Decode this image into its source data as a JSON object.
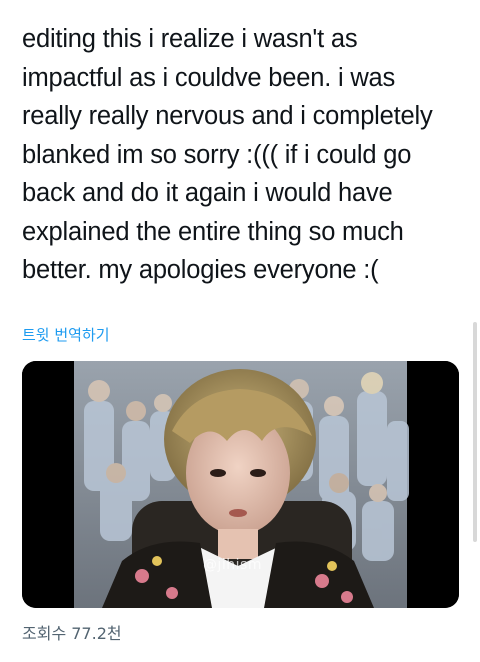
{
  "tweet": {
    "text": "editing this i realize i wasn't as\nimpactful as i couldve been. i was\nreally really nervous and i completely\nblanked im so sorry :((( if i could go\nback and do it again i would have\nexplained the entire thing so much\nbetter. my apologies everyone :(",
    "translate_label": "트윗 번역하기",
    "views_label": "조회수 77.2천"
  },
  "media": {
    "type": "video-thumbnail",
    "watermark": "@jihism"
  },
  "colors": {
    "link": "#1d9bf0",
    "secondary_text": "#536471",
    "primary_text": "#0f1419"
  }
}
